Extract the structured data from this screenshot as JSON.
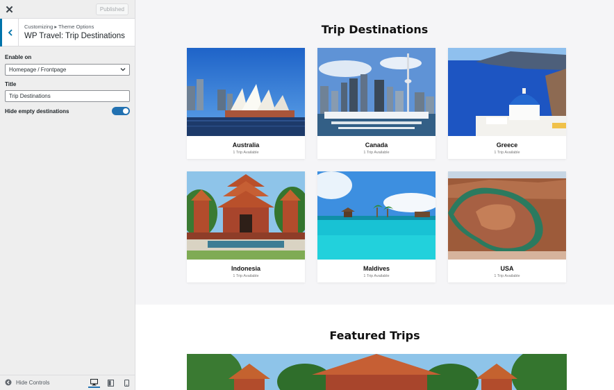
{
  "customizer": {
    "close_icon": "close-icon",
    "publish_label": "Published",
    "breadcrumb": "Customizing ▸ Theme Options",
    "section_title": "WP Travel: Trip Destinations",
    "enable_on": {
      "label": "Enable on",
      "value": "Homepage / Frontpage"
    },
    "title_field": {
      "label": "Title",
      "value": "Trip Destinations"
    },
    "hide_empty": {
      "label": "Hide empty destinations",
      "enabled": true
    },
    "footer": {
      "hide_controls_label": "Hide Controls",
      "devices": [
        "desktop-icon",
        "tablet-icon",
        "mobile-icon"
      ],
      "active_device": "desktop"
    },
    "colors": {
      "accent": "#2271b1",
      "back_border": "#0073aa"
    }
  },
  "preview": {
    "destinations_heading": "Trip Destinations",
    "destinations": [
      {
        "name": "Australia",
        "count": "1 Trip Available",
        "image": "sydney-opera-house"
      },
      {
        "name": "Canada",
        "count": "1 Trip Available",
        "image": "toronto-skyline"
      },
      {
        "name": "Greece",
        "count": "1 Trip Available",
        "image": "santorini"
      },
      {
        "name": "Indonesia",
        "count": "1 Trip Available",
        "image": "balinese-temple"
      },
      {
        "name": "Maldives",
        "count": "1 Trip Available",
        "image": "tropical-lagoon"
      },
      {
        "name": "USA",
        "count": "1 Trip Available",
        "image": "horseshoe-bend"
      }
    ],
    "featured_heading": "Featured Trips",
    "featured_image": "balinese-temple"
  }
}
